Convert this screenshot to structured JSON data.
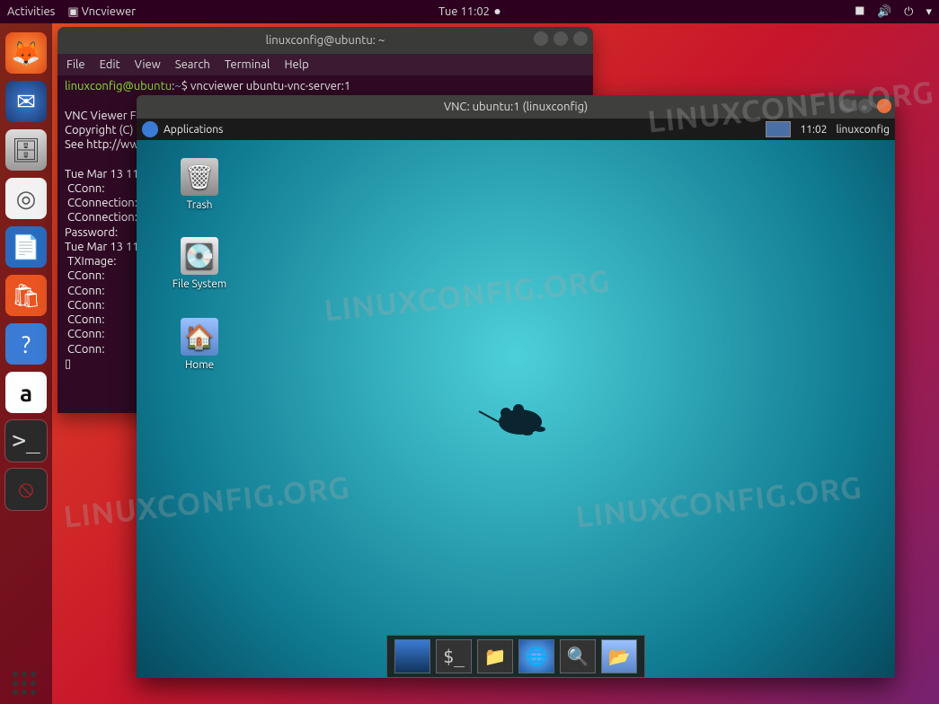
{
  "topbar": {
    "activities": "Activities",
    "app_indicator": "Vncviewer",
    "clock": "Tue 11:02"
  },
  "dock": {
    "items": [
      {
        "name": "firefox",
        "glyph": "🦊"
      },
      {
        "name": "thunderbird",
        "glyph": "✉"
      },
      {
        "name": "files",
        "glyph": "🗄"
      },
      {
        "name": "rhythmbox",
        "glyph": "◎"
      },
      {
        "name": "writer",
        "glyph": "📄"
      },
      {
        "name": "software",
        "glyph": "🛍"
      },
      {
        "name": "help",
        "glyph": "❓"
      },
      {
        "name": "amazon",
        "glyph": "a"
      },
      {
        "name": "terminal",
        "glyph": ">_"
      },
      {
        "name": "no-entry",
        "glyph": "⦸"
      }
    ]
  },
  "terminal": {
    "title": "linuxconfig@ubuntu: ~",
    "menu": [
      "File",
      "Edit",
      "View",
      "Search",
      "Terminal",
      "Help"
    ],
    "prompt_user": "linuxconfig@ubuntu",
    "prompt_sep": ":",
    "prompt_path": "~",
    "prompt_sym": "$",
    "command": "vncviewer ubuntu-vnc-server:1",
    "output_lines": [
      "",
      "VNC Viewer Fr",
      "Copyright (C)",
      "See http://ww",
      "",
      "Tue Mar 13 11",
      " CConn:",
      " CConnection:",
      " CConnection:",
      "Password:",
      "Tue Mar 13 11",
      " TXImage:",
      " CConn:",
      " CConn:",
      " CConn:",
      " CConn:",
      " CConn:",
      " CConn:",
      "▯"
    ]
  },
  "vnc": {
    "title": "VNC: ubuntu:1 (linuxconfig)",
    "panel": {
      "applications": "Applications",
      "clock": "11:02",
      "user": "linuxconfig"
    },
    "desktop_icons": {
      "trash": "Trash",
      "filesystem": "File System",
      "home": "Home"
    },
    "dock_items": [
      "desktop",
      "terminal",
      "files",
      "web",
      "find",
      "folder"
    ]
  },
  "watermark": "LINUXCONFIG.ORG"
}
